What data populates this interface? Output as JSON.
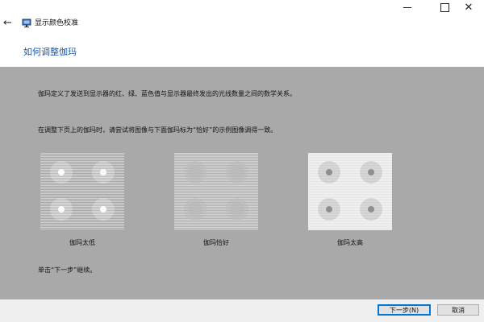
{
  "window": {
    "title": "显示颜色校准",
    "controls": {
      "minimize": "minimize",
      "maximize": "maximize",
      "close": "✕"
    }
  },
  "header": {
    "heading": "如何调整伽玛"
  },
  "main": {
    "description_1": "伽玛定义了发送到显示器的红、绿、蓝色值与显示器最终发出的光线数量之间的数学关系。",
    "description_2": "在调整下页上的伽玛时，请尝试将图像与下面伽玛标为“恰好”的示例图像调得一致。",
    "examples": [
      {
        "label": "伽玛太低",
        "stripe_light": "#cfcfcf",
        "stripe_dark": "#a9a9a9",
        "dot_color": "#ffffff",
        "dot_style": "bright"
      },
      {
        "label": "伽玛恰好",
        "stripe_light": "#d4d4d4",
        "stripe_dark": "#b4b4b4",
        "dot_color": "#b9b9b9",
        "dot_style": "matched"
      },
      {
        "label": "伽玛太高",
        "stripe_light": "#f2f2f2",
        "stripe_dark": "#e6e6e6",
        "dot_color": "#8c8c8c",
        "dot_style": "dark"
      }
    ],
    "continue_text": "单击“下一步”继续。"
  },
  "footer": {
    "next_label": "下一步(N)",
    "cancel_label": "取消"
  },
  "colors": {
    "content_bg": "#a9a9a9",
    "heading": "#1a56a8",
    "accent_border": "#0078d7"
  }
}
